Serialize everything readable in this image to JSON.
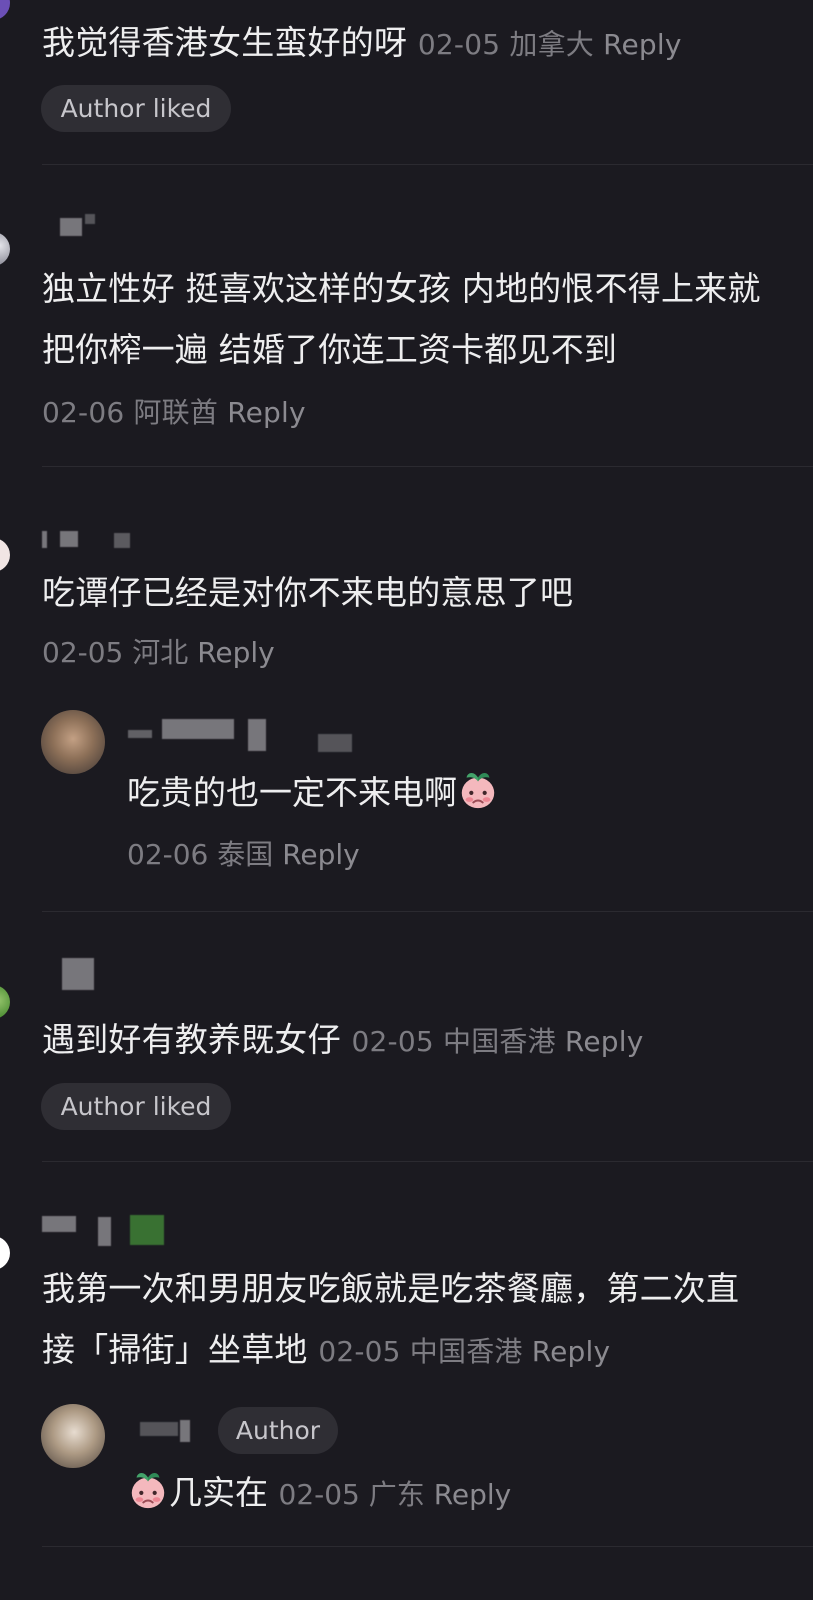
{
  "comments": [
    {
      "text": "我觉得香港女生蛮好的呀",
      "date": "02-05",
      "location": "加拿大",
      "reply_label": "Reply",
      "author_liked": "Author liked"
    },
    {
      "text": "独立性好 挺喜欢这样的女孩 内地的恨不得上来就把你榨一遍 结婚了你连工资卡都见不到",
      "date": "02-06",
      "location": "阿联酋",
      "reply_label": "Reply"
    },
    {
      "text": "吃谭仔已经是对你不来电的意思了吧",
      "date": "02-05",
      "location": "河北",
      "reply_label": "Reply",
      "reply": {
        "text": "吃贵的也一定不来电啊",
        "emoji": "blushing-peach-sticker-icon",
        "date": "02-06",
        "location": "泰国",
        "reply_label": "Reply"
      }
    },
    {
      "text": "遇到好有教养既女仔",
      "date": "02-05",
      "location": "中国香港",
      "reply_label": "Reply",
      "author_liked": "Author liked"
    },
    {
      "text": "我第一次和男朋友吃飯就是吃茶餐廳，第二次直接「掃街」坐草地",
      "date": "02-05",
      "location": "中国香港",
      "reply_label": "Reply",
      "reply": {
        "author_badge": "Author",
        "text": "几实在",
        "emoji": "blushing-peach-sticker-icon",
        "date": "02-05",
        "location": "广东",
        "reply_label": "Reply"
      }
    }
  ],
  "colors": {
    "background": "#1b1a20",
    "body_text": "#eeeeef",
    "meta_text": "#7d7c82",
    "chip_background": "#2f2e34",
    "divider": "#2b2a30"
  }
}
